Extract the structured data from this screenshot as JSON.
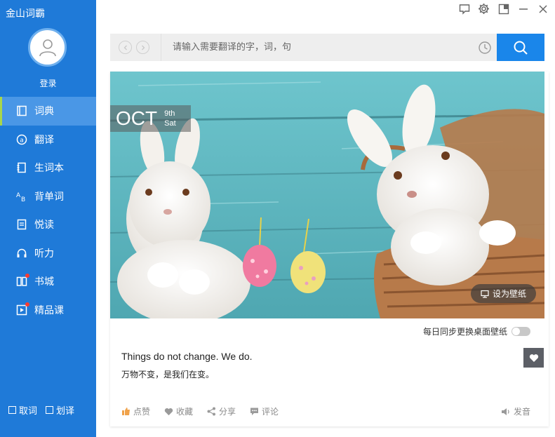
{
  "app": {
    "title": "金山词霸",
    "login": "登录"
  },
  "sidebar": {
    "items": [
      {
        "label": "词典",
        "icon": "book-icon",
        "active": true,
        "dot": false
      },
      {
        "label": "翻译",
        "icon": "translate-icon",
        "active": false,
        "dot": false
      },
      {
        "label": "生词本",
        "icon": "notebook-icon",
        "active": false,
        "dot": false
      },
      {
        "label": "背单词",
        "icon": "ab-icon",
        "active": false,
        "dot": false
      },
      {
        "label": "悦读",
        "icon": "reading-icon",
        "active": false,
        "dot": false
      },
      {
        "label": "听力",
        "icon": "headphones-icon",
        "active": false,
        "dot": false
      },
      {
        "label": "书城",
        "icon": "bookstore-icon",
        "active": false,
        "dot": true
      },
      {
        "label": "精品课",
        "icon": "play-icon",
        "active": false,
        "dot": true
      }
    ],
    "bottom": {
      "quick_lookup": "取词",
      "select_translate": "划译"
    }
  },
  "search": {
    "placeholder": "请输入需要翻译的字，词，句"
  },
  "card": {
    "date": {
      "month": "OCT",
      "day": "9th",
      "weekday": "Sat"
    },
    "wallpaper_button": "设为壁纸",
    "sync_label": "每日同步更换桌面壁纸",
    "sentence_en": "Things do not change. We do.",
    "sentence_cn": "万物不变，是我们在变。",
    "actions": {
      "like": "点赞",
      "collect": "收藏",
      "share": "分享",
      "comment": "评论"
    },
    "pronounce": "发音"
  },
  "colors": {
    "sidebar": "#1f7ad8",
    "active_item": "#4a97e6",
    "search_button": "#1a86ea",
    "accent_like": "#f0a24a"
  }
}
